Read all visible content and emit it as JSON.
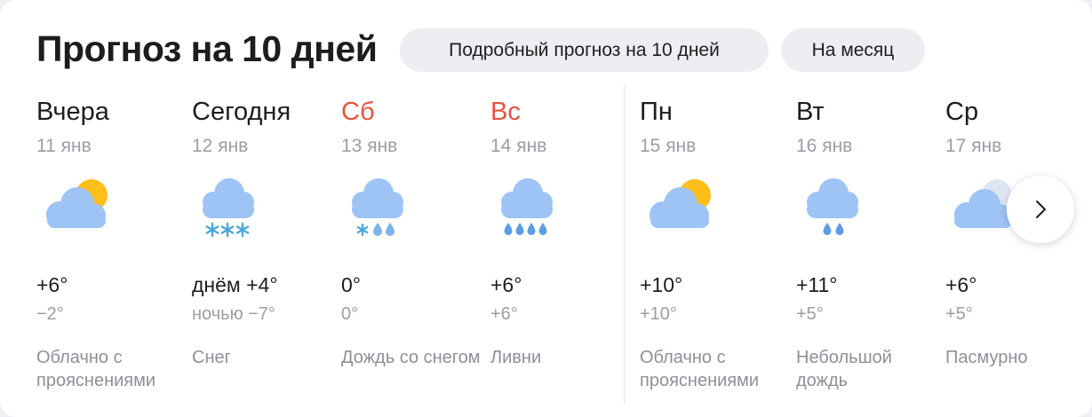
{
  "header": {
    "title": "Прогноз на 10 дней",
    "detailed_button": "Подробный прогноз на 10 дней",
    "month_button": "На месяц"
  },
  "days": [
    {
      "name": "Вчера",
      "date": "11 янв",
      "day_temp": "+6°",
      "night_temp": "−2°",
      "desc": "Облачно с прояснениями",
      "icon": "partly-cloudy-icon",
      "weekend": false
    },
    {
      "name": "Сегодня",
      "date": "12 янв",
      "day_temp": "днём +4°",
      "night_temp": "ночью −7°",
      "desc": "Снег",
      "icon": "snow-icon",
      "weekend": false
    },
    {
      "name": "Сб",
      "date": "13 янв",
      "day_temp": "0°",
      "night_temp": "0°",
      "desc": "Дождь со снегом",
      "icon": "sleet-icon",
      "weekend": true
    },
    {
      "name": "Вс",
      "date": "14 янв",
      "day_temp": "+6°",
      "night_temp": "+6°",
      "desc": "Ливни",
      "icon": "showers-icon",
      "weekend": true
    },
    {
      "name": "Пн",
      "date": "15 янв",
      "day_temp": "+10°",
      "night_temp": "+10°",
      "desc": "Облачно с прояснениями",
      "icon": "partly-cloudy-icon",
      "weekend": false
    },
    {
      "name": "Вт",
      "date": "16 янв",
      "day_temp": "+11°",
      "night_temp": "+5°",
      "desc": "Небольшой дождь",
      "icon": "light-rain-icon",
      "weekend": false
    },
    {
      "name": "Ср",
      "date": "17 янв",
      "day_temp": "+6°",
      "night_temp": "+5°",
      "desc": "Пасмурно",
      "icon": "overcast-icon",
      "weekend": false
    }
  ],
  "colors": {
    "weekend": "#e8523f",
    "cloud": "#9ec3f5",
    "sun": "#ffbf1a",
    "rain": "#5e9de6",
    "snow": "#4aa7dc"
  }
}
